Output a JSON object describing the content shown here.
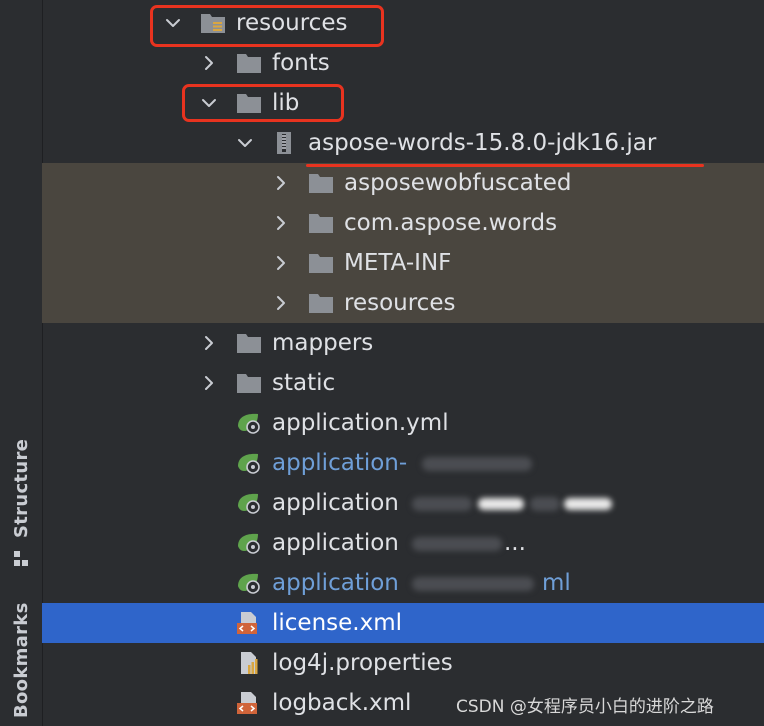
{
  "sidebar": {
    "structure_label": "Structure",
    "bookmarks_label": "Bookmarks"
  },
  "tree": {
    "resources": "resources",
    "fonts": "fonts",
    "lib": "lib",
    "jar": "aspose-words-15.8.0-jdk16.jar",
    "asposewobfuscated": "asposewobfuscated",
    "com_aspose_words": "com.aspose.words",
    "meta_inf": "META-INF",
    "jar_resources": "resources",
    "mappers": "mappers",
    "static": "static",
    "app_yml": "application.yml",
    "app_2": "application-",
    "app_3": "application",
    "app_4": "application",
    "app_4_suffix": "...",
    "app_5": "application",
    "app_5_suffix": "ml",
    "license": "license.xml",
    "log4j": "log4j.properties",
    "logback": "logback.xml"
  },
  "watermark": "CSDN @女程序员小白的进阶之路",
  "colors": {
    "background": "#2b2d30",
    "selection": "#2f65ca",
    "jar_highlight": "#4a463f",
    "annotation_red": "#e8331f",
    "modified_blue": "#6f9fd8"
  }
}
